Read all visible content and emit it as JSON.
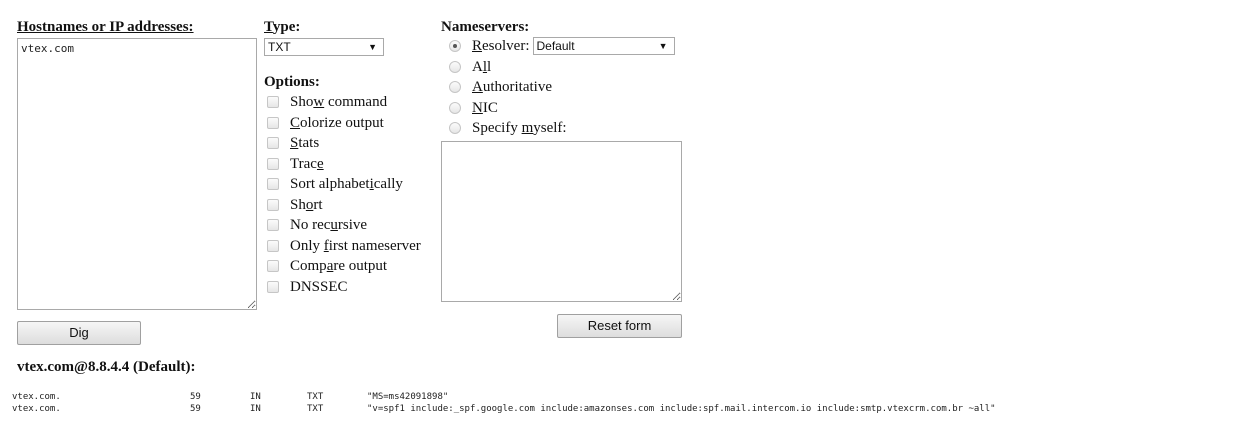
{
  "hosts_column": {
    "title": "Hostnames or IP addresses:",
    "textarea_value": "vtex.com"
  },
  "type_column": {
    "title_first": "T",
    "title_rest": "ype:",
    "selected": "TXT",
    "options_title": "Options:",
    "options": [
      {
        "pre": "Sho",
        "u": "w",
        "post": " command"
      },
      {
        "pre": "",
        "u": "C",
        "post": "olorize output"
      },
      {
        "pre": "",
        "u": "S",
        "post": "tats"
      },
      {
        "pre": "Trac",
        "u": "e",
        "post": ""
      },
      {
        "pre": "Sort alphabet",
        "u": "i",
        "post": "cally"
      },
      {
        "pre": "Sh",
        "u": "o",
        "post": "rt"
      },
      {
        "pre": "No rec",
        "u": "u",
        "post": "rsive"
      },
      {
        "pre": "Only ",
        "u": "f",
        "post": "irst nameserver"
      },
      {
        "pre": "Comp",
        "u": "a",
        "post": "re output"
      },
      {
        "pre": "DNSSEC",
        "u": "",
        "post": ""
      }
    ]
  },
  "nameservers_column": {
    "title": "Nameservers:",
    "resolver": {
      "pre": "",
      "u": "R",
      "post": "esolver:"
    },
    "resolver_selected": "Default",
    "radios": [
      {
        "pre": "A",
        "u": "l",
        "post": "l"
      },
      {
        "pre": "",
        "u": "A",
        "post": "uthoritative"
      },
      {
        "pre": "",
        "u": "N",
        "post": "IC"
      },
      {
        "pre": "Specify ",
        "u": "m",
        "post": "yself:"
      }
    ],
    "textarea_value": ""
  },
  "buttons": {
    "dig": "Dig",
    "reset": "Reset form"
  },
  "result": {
    "title": "vtex.com@8.8.4.4 (Default):",
    "rows": [
      {
        "name": "vtex.com.",
        "ttl": "59",
        "class": "IN",
        "type": "TXT",
        "data": "\"MS=ms42091898\""
      },
      {
        "name": "vtex.com.",
        "ttl": "59",
        "class": "IN",
        "type": "TXT",
        "data": "\"v=spf1 include:_spf.google.com include:amazonses.com include:spf.mail.intercom.io include:smtp.vtexcrm.com.br ~all\""
      }
    ]
  }
}
